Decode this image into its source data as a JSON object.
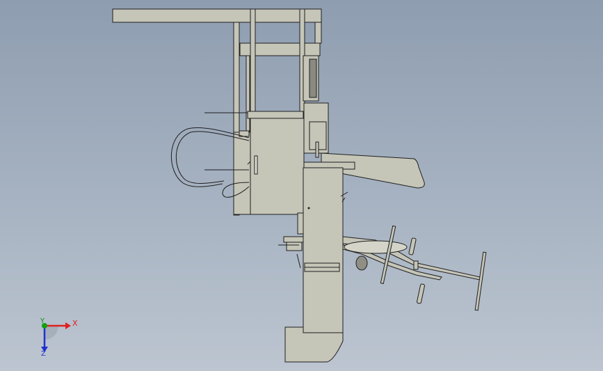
{
  "viewport": {
    "background_top": "#8e9db0",
    "background_bottom": "#bcc5d0",
    "part_fill": "#c5c5b8",
    "edge_color": "#1f1f1f"
  },
  "triad": {
    "x_label": "X",
    "y_label": "Y",
    "z_label": "Z",
    "x_color": "#e02020",
    "y_color": "#0e8a12",
    "z_color": "#2030d0"
  }
}
